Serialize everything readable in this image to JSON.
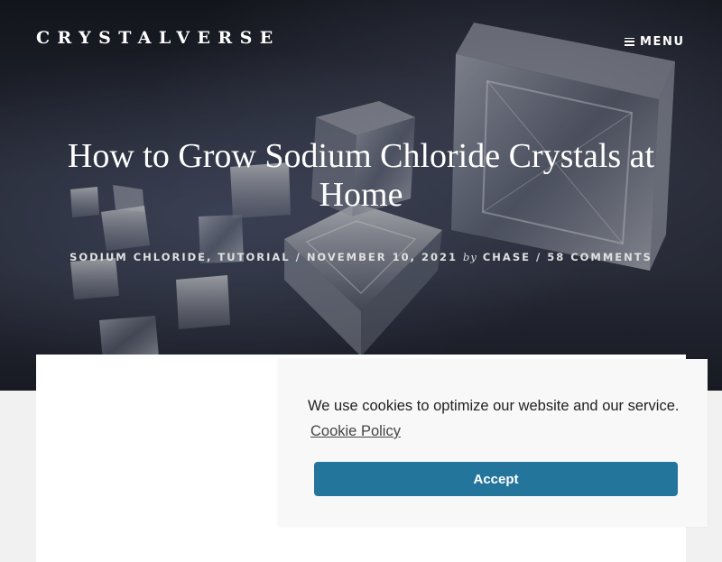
{
  "site": {
    "logo": "CRYSTALVERSE",
    "menu_label": "MENU"
  },
  "post": {
    "title": "How to Grow Sodium Chloride Crystals at Home",
    "categories": [
      "SODIUM CHLORIDE",
      "TUTORIAL"
    ],
    "date": "NOVEMBER 10, 2021",
    "by": "by",
    "author": "CHASE",
    "comments": "58 COMMENTS",
    "sep_comma": ", ",
    "sep_slash": " / "
  },
  "cookie": {
    "message": "We use cookies to optimize our website and our service.",
    "policy_link": "Cookie Policy",
    "accept_label": "Accept",
    "accent": "#24759c"
  },
  "hero": {
    "image": "salt-crystals-photo"
  },
  "icons": {
    "menu": "hamburger-icon"
  }
}
